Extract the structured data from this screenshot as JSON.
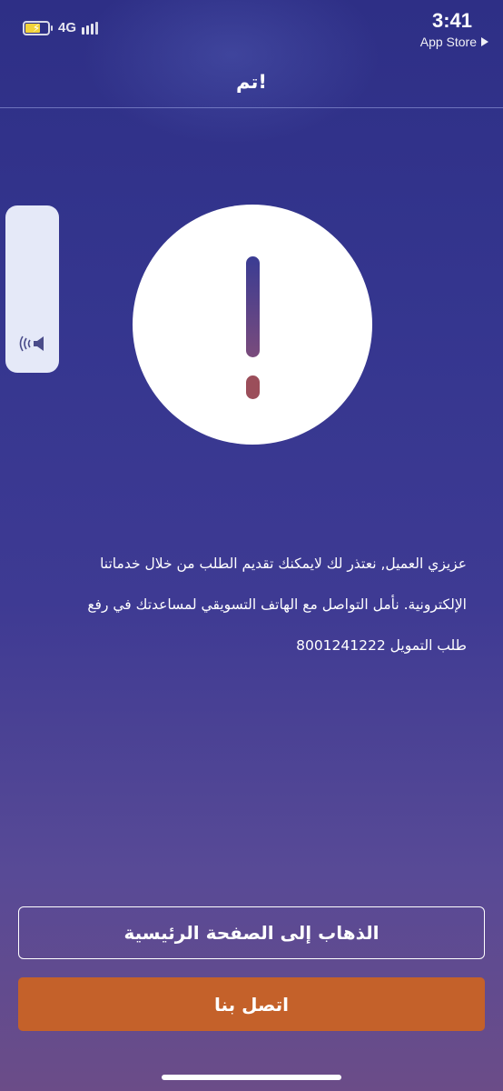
{
  "status_bar": {
    "network": "4G",
    "time": "3:41",
    "back_app": "App Store",
    "icons": {
      "battery": "battery-charging-icon",
      "signal": "signal-bars-icon",
      "back": "play-triangle-icon"
    },
    "battery_level": 0.55
  },
  "header": {
    "title": "تم!"
  },
  "side_widget": {
    "icon": "speaker-icon"
  },
  "alert": {
    "icon": "exclamation-icon"
  },
  "message": {
    "lines": [
      "عزيزي العميل, نعتذر لك لايمكنك تقديم الطلب من خلال خدماتنا",
      "الإلكترونية. نأمل التواصل مع الهاتف التسويقي لمساعدتك في رفع",
      "طلب التمويل 8001241222"
    ]
  },
  "buttons": {
    "home_label": "الذهاب إلى الصفحة الرئيسية",
    "contact_label": "اتصل بنا"
  },
  "colors": {
    "background_top": "#2e2f86",
    "background_bottom": "#6b4c88",
    "accent": "#c4612a",
    "battery_fill": "#f3d33a",
    "exclamation_dot": "#9b4e5a"
  }
}
